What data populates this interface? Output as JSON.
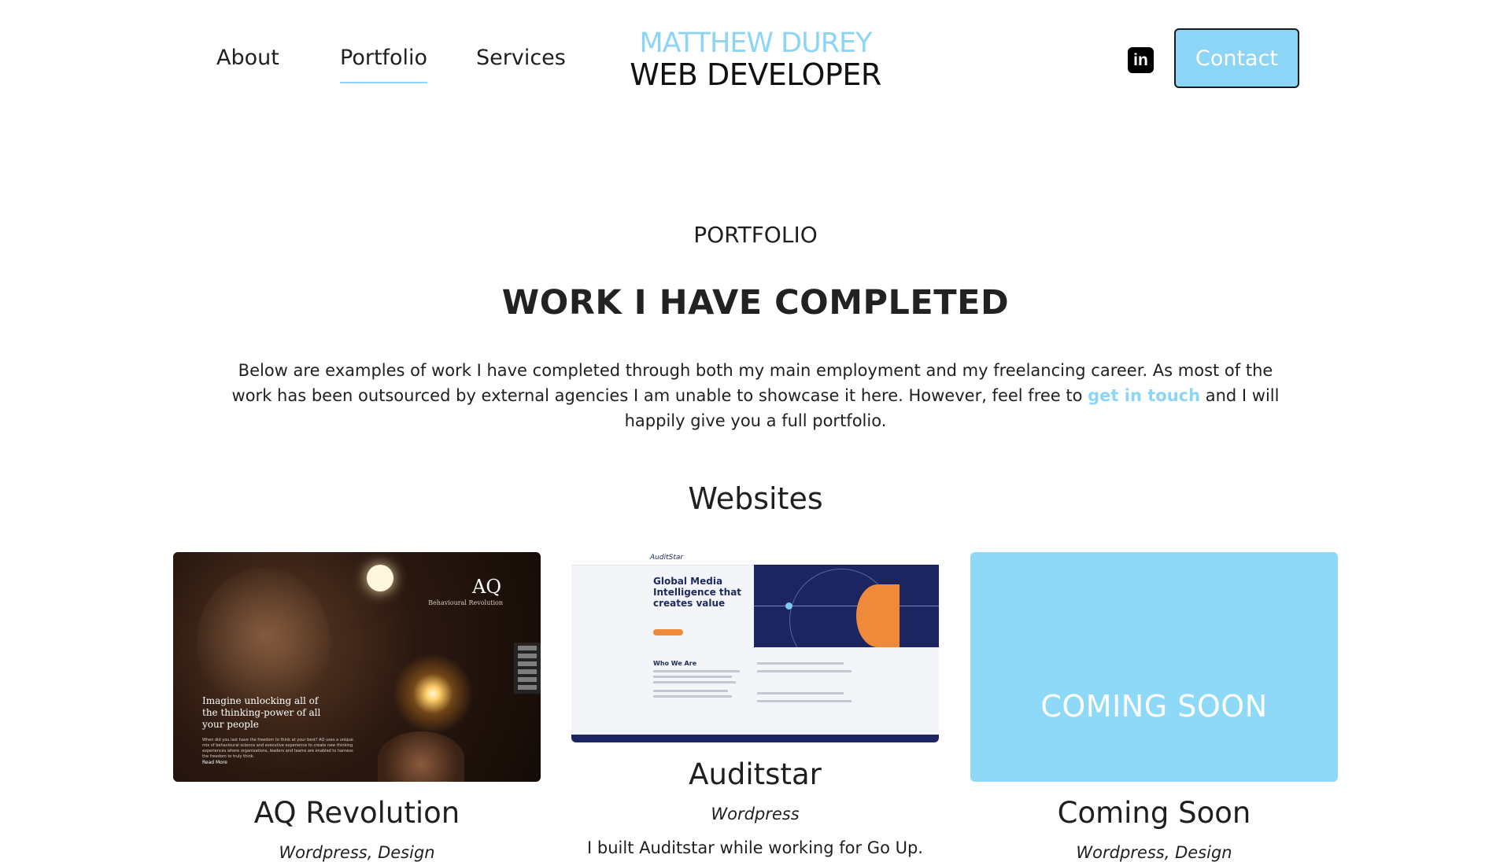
{
  "header": {
    "nav": [
      {
        "label": "About",
        "active": false
      },
      {
        "label": "Portfolio",
        "active": true
      },
      {
        "label": "Services",
        "active": false
      }
    ],
    "logo_line1": "MATTHEW DUREY",
    "logo_line2": "WEB DEVELOPER",
    "linkedin_icon": "linkedin-icon",
    "linkedin_glyph": "in",
    "contact_label": "Contact"
  },
  "intro": {
    "kicker": "PORTFOLIO",
    "headline": "WORK I HAVE COMPLETED",
    "text_before": "Below are examples of work I have completed through both my main employment and my freelancing career. As most of the work has been outsourced by external agencies I am unable to showcase it here. However, feel free to ",
    "link_text": "get in touch",
    "text_after": " and I will happily give you a full portfolio."
  },
  "section_title": "Websites",
  "cards": [
    {
      "title": "AQ Revolution",
      "category": "Wordpress, Design",
      "thumb": {
        "logo": "AQ",
        "logo_sub": "Behavioural Revolution",
        "menu_items": [
          "Home",
          "Services",
          "People",
          "Thinking",
          "Clients",
          "Contact Us"
        ],
        "heading": "Imagine unlocking all of the thinking-power of all your people",
        "body": "When did you last have the freedom to think at your best? AQ uses a unique mix of behavioural science and executive experience to create new thinking experiences where organisations, leaders and teams are enabled to harness the freedom to truly think.",
        "read_more": "Read More"
      }
    },
    {
      "title": "Auditstar",
      "category": "Wordpress",
      "description": "I built Auditstar while working for Go Up.",
      "thumb": {
        "brand": "AuditStar",
        "heading": "Global Media Intelligence that creates value",
        "who_we_are": "Who We Are"
      }
    },
    {
      "title": "Coming Soon",
      "category": "Wordpress, Design",
      "thumb_text": "COMING SOON"
    }
  ],
  "colors": {
    "accent": "#8dd5f7",
    "coming_soon_bg": "#8ed8f8",
    "text": "#1f1f1f"
  }
}
